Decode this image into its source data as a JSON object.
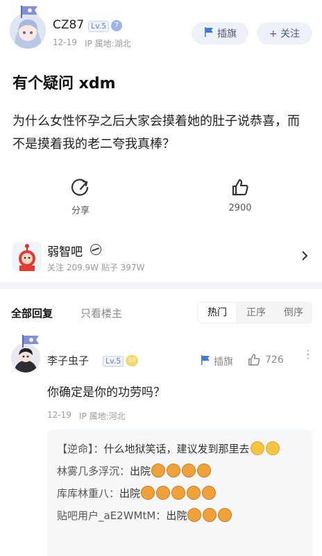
{
  "post": {
    "author": "CZ87",
    "level": "Lv.5",
    "date": "12-19",
    "ip": "IP 属地:湖北",
    "flag_button": "插旗",
    "follow_button": "+ 关注",
    "title": "有个疑问 xdm",
    "body": "为什么女性怀孕之后大家会摸着她的肚子说恭喜，而不是摸着我的老二夸我真棒？",
    "share_label": "分享",
    "like_count": "2900"
  },
  "forum": {
    "name": "弱智吧",
    "stats": "关注 209.9W   贴子 397W"
  },
  "tabs": {
    "all": "全部回复",
    "op_only": "只看楼主",
    "sort": [
      "热门",
      "正序",
      "倒序"
    ]
  },
  "reply": {
    "author": "李子虫子",
    "level": "Lv.5",
    "flag_label": "插旗",
    "like_count": "726",
    "text": "你确定是你的功劳吗？",
    "date": "12-19",
    "ip": "IP 属地:河北",
    "subreplies": [
      {
        "who": "【逆命】：",
        "text": "什么地狱笑话，建议发到那里去"
      },
      {
        "who": "林雾几多浮沉：",
        "text": "出院"
      },
      {
        "who": "库库林重八：",
        "text": "出院"
      },
      {
        "who": "贴吧用户_aE2WMtM：",
        "text": "出院"
      }
    ]
  },
  "colors": {
    "accent": "#4a5a7a",
    "pill_bg": "#eef2f8",
    "meta_gray": "#9a9a9a"
  }
}
